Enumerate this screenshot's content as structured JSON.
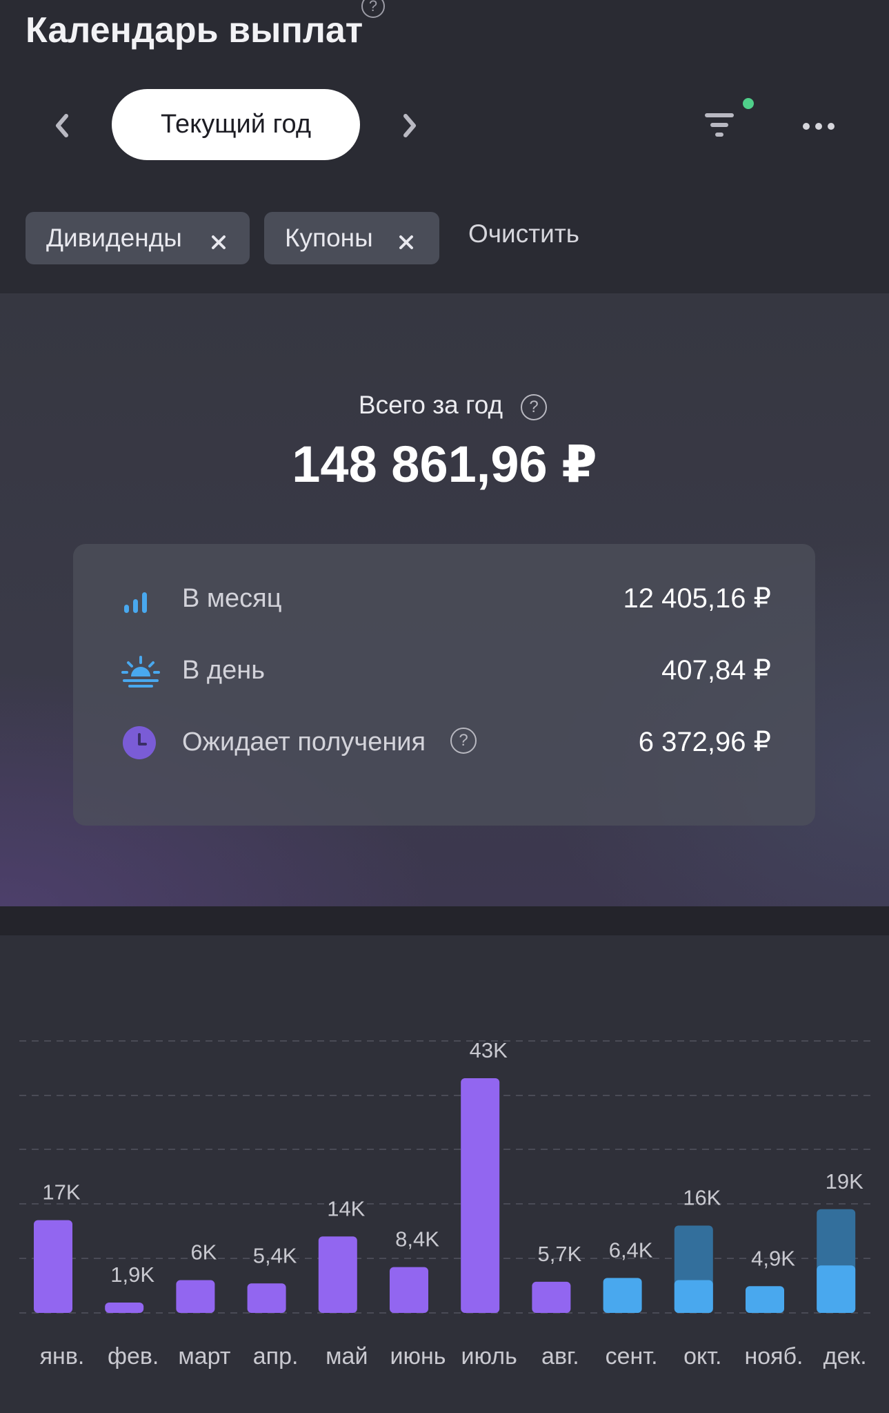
{
  "header": {
    "title": "Календарь выплат",
    "help_icon": "help-circle-icon",
    "period_label": "Текущий год",
    "prev_icon": "chevron-left-icon",
    "next_icon": "chevron-right-icon",
    "filter_icon": "filter-icon",
    "more_icon": "more-horizontal-icon",
    "filter_active_color": "#4fcf8a"
  },
  "filters": {
    "chips": [
      {
        "label": "Дивиденды",
        "remove_icon": "close-icon"
      },
      {
        "label": "Купоны",
        "remove_icon": "close-icon"
      }
    ],
    "clear_label": "Очистить"
  },
  "summary": {
    "total_label": "Всего за год",
    "total_value": "148 861,96 ₽",
    "rows": [
      {
        "icon": "bar-chart-icon",
        "label": "В месяц",
        "value": "12 405,16 ₽"
      },
      {
        "icon": "sunrise-icon",
        "label": "В день",
        "value": "407,84 ₽"
      },
      {
        "icon": "clock-icon",
        "label": "Ожидает получения",
        "value": "6 372,96 ₽",
        "help_icon": "help-circle-icon"
      }
    ]
  },
  "chart_data": {
    "type": "bar",
    "categories": [
      "янв.",
      "фев.",
      "март",
      "апр.",
      "май",
      "июнь",
      "июль",
      "авг.",
      "сент.",
      "окт.",
      "нояб.",
      "дек."
    ],
    "value_labels": [
      "17K",
      "1,9K",
      "6K",
      "5,4K",
      "14K",
      "8,4K",
      "43K",
      "5,7K",
      "6,4K",
      "16K",
      "4,9K",
      "19K"
    ],
    "values": [
      17000,
      1900,
      6000,
      5400,
      14000,
      8400,
      43000,
      5700,
      6400,
      16000,
      4900,
      19000
    ],
    "received": [
      17000,
      1900,
      6000,
      5400,
      14000,
      8400,
      43000,
      5700,
      6400,
      6000,
      4900,
      8700
    ],
    "bar_colors": [
      "#9266f0",
      "#9266f0",
      "#9266f0",
      "#9266f0",
      "#9266f0",
      "#9266f0",
      "#9266f0",
      "#9266f0",
      "#49a8ee",
      "#49a8ee",
      "#49a8ee",
      "#49a8ee"
    ],
    "pending_color": "#336f9c",
    "ylim": [
      0,
      50000
    ],
    "grid": true
  }
}
